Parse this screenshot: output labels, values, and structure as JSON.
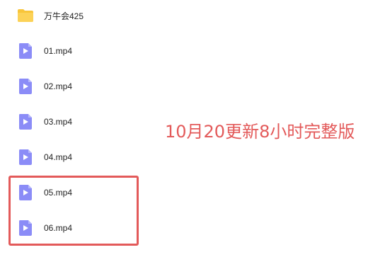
{
  "files": [
    {
      "name": "万牛会425",
      "type": "folder",
      "icon": "folder-icon"
    },
    {
      "name": "01.mp4",
      "type": "video",
      "icon": "video-file-icon"
    },
    {
      "name": "02.mp4",
      "type": "video",
      "icon": "video-file-icon"
    },
    {
      "name": "03.mp4",
      "type": "video",
      "icon": "video-file-icon"
    },
    {
      "name": "04.mp4",
      "type": "video",
      "icon": "video-file-icon"
    },
    {
      "name": "05.mp4",
      "type": "video",
      "icon": "video-file-icon"
    },
    {
      "name": "06.mp4",
      "type": "video",
      "icon": "video-file-icon"
    }
  ],
  "annotation": {
    "text": "10月20更新8小时完整版"
  },
  "colors": {
    "folder": "#f8c53a",
    "video_icon": "#8b8cf7",
    "highlight": "#e35a5a"
  }
}
